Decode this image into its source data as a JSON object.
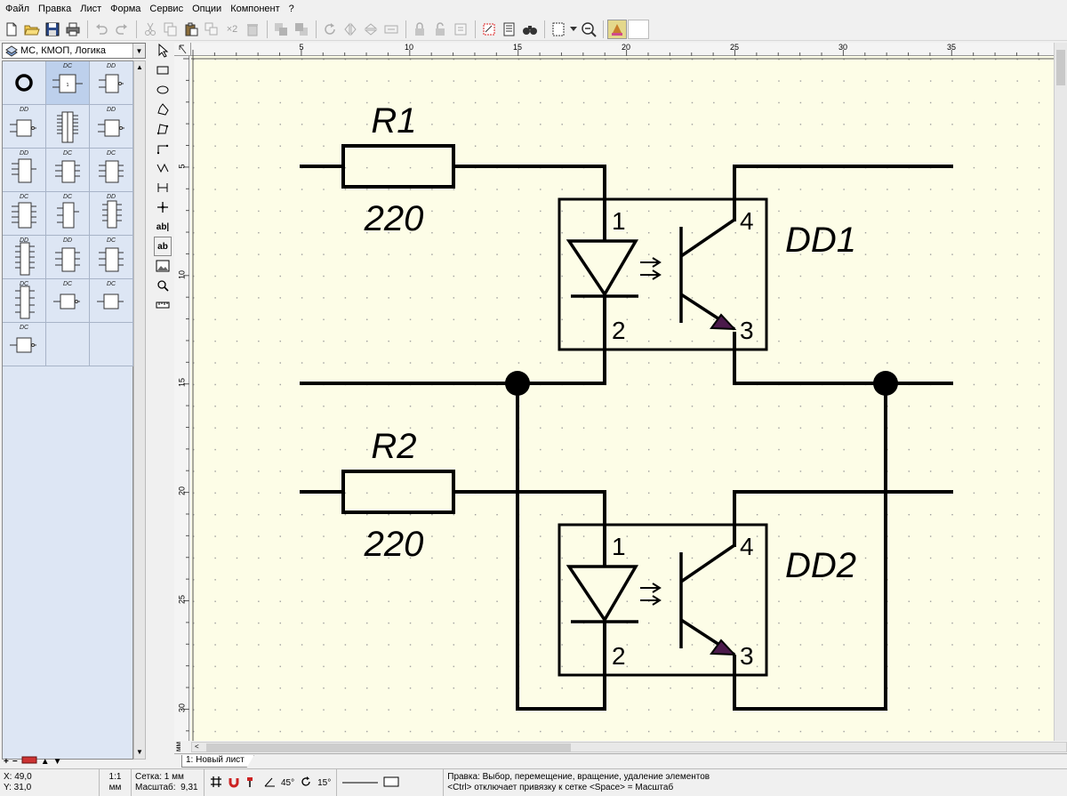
{
  "menu": [
    "Файл",
    "Правка",
    "Лист",
    "Форма",
    "Сервис",
    "Опции",
    "Компонент",
    "?"
  ],
  "toolbar": {
    "multiply_label": "×2"
  },
  "library": {
    "selected": "МС, КМОП, Логика"
  },
  "components": [
    {
      "label": ""
    },
    {
      "label": "DC"
    },
    {
      "label": "DD"
    },
    {
      "label": "DD"
    },
    {
      "label": ""
    },
    {
      "label": "DD"
    },
    {
      "label": "DD"
    },
    {
      "label": "DC"
    },
    {
      "label": "DC"
    },
    {
      "label": "DC"
    },
    {
      "label": "DC"
    },
    {
      "label": "DD"
    },
    {
      "label": "DD"
    },
    {
      "label": "DD"
    },
    {
      "label": "DC"
    },
    {
      "label": "DC"
    },
    {
      "label": "DC"
    },
    {
      "label": "DC"
    },
    {
      "label": "DC"
    }
  ],
  "drawtools": {
    "text_label_1": "ab|",
    "text_label_2": "ab"
  },
  "ruler": {
    "top": [
      "5",
      "10",
      "15",
      "20",
      "25",
      "30",
      "35"
    ],
    "left": [
      "5",
      "10",
      "15",
      "20",
      "25",
      "30"
    ],
    "unit": "мм"
  },
  "schematic": {
    "r1": {
      "ref": "R1",
      "value": "220"
    },
    "r2": {
      "ref": "R2",
      "value": "220"
    },
    "dd1": {
      "ref": "DD1",
      "pins": [
        "1",
        "2",
        "3",
        "4"
      ]
    },
    "dd2": {
      "ref": "DD2",
      "pins": [
        "1",
        "2",
        "3",
        "4"
      ]
    }
  },
  "sheet_tabs": [
    "1: Новый лист"
  ],
  "status": {
    "x": "X: 49,0",
    "y": "Y: 31,0",
    "scale_ratio": "1:1",
    "scale_unit": "мм",
    "grid": "Сетка: 1 мм",
    "zoom_label": "Масштаб:",
    "zoom_value": "9,31",
    "angle1": "45°",
    "angle2": "15°",
    "hint1": "Правка: Выбор, перемещение, вращение, удаление элементов",
    "hint2": "<Ctrl> отключает привязку к сетке <Space> = Масштаб"
  },
  "colors": {
    "canvas_bg": "#fdfde7",
    "panel_bg": "#dde6f4",
    "arrow_fill": "#4b1a4b"
  }
}
